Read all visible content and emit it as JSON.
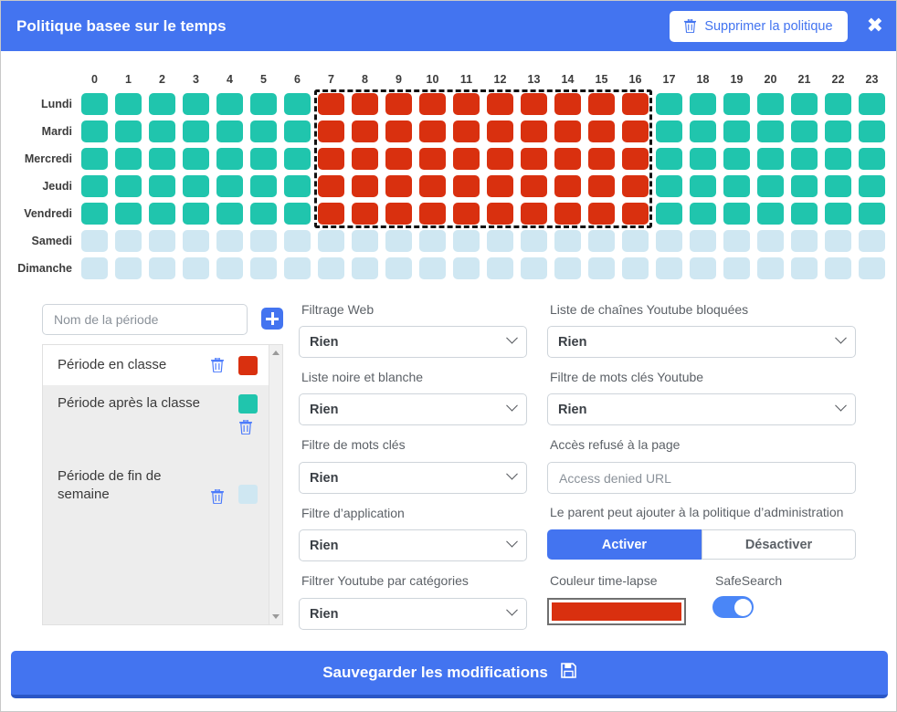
{
  "header": {
    "title": "Politique basee sur le temps",
    "delete_policy_label": "Supprimer la politique",
    "delete_icon": "trash-icon",
    "close_icon": "close-icon"
  },
  "schedule": {
    "hours": [
      "0",
      "1",
      "2",
      "3",
      "4",
      "5",
      "6",
      "7",
      "8",
      "9",
      "10",
      "11",
      "12",
      "13",
      "14",
      "15",
      "16",
      "17",
      "18",
      "19",
      "20",
      "21",
      "22",
      "23"
    ],
    "days": [
      "Lundi",
      "Mardi",
      "Mercredi",
      "Jeudi",
      "Vendredi",
      "Samedi",
      "Dimanche"
    ],
    "colors": {
      "in_class": "#d9300f",
      "after_class": "#20c5ad",
      "weekend": "#cfe7f2",
      "selection_border": "#111111"
    },
    "cells": [
      [
        "after_class",
        "after_class",
        "after_class",
        "after_class",
        "after_class",
        "after_class",
        "after_class",
        "in_class",
        "in_class",
        "in_class",
        "in_class",
        "in_class",
        "in_class",
        "in_class",
        "in_class",
        "in_class",
        "in_class",
        "after_class",
        "after_class",
        "after_class",
        "after_class",
        "after_class",
        "after_class",
        "after_class"
      ],
      [
        "after_class",
        "after_class",
        "after_class",
        "after_class",
        "after_class",
        "after_class",
        "after_class",
        "in_class",
        "in_class",
        "in_class",
        "in_class",
        "in_class",
        "in_class",
        "in_class",
        "in_class",
        "in_class",
        "in_class",
        "after_class",
        "after_class",
        "after_class",
        "after_class",
        "after_class",
        "after_class",
        "after_class"
      ],
      [
        "after_class",
        "after_class",
        "after_class",
        "after_class",
        "after_class",
        "after_class",
        "after_class",
        "in_class",
        "in_class",
        "in_class",
        "in_class",
        "in_class",
        "in_class",
        "in_class",
        "in_class",
        "in_class",
        "in_class",
        "after_class",
        "after_class",
        "after_class",
        "after_class",
        "after_class",
        "after_class",
        "after_class"
      ],
      [
        "after_class",
        "after_class",
        "after_class",
        "after_class",
        "after_class",
        "after_class",
        "after_class",
        "in_class",
        "in_class",
        "in_class",
        "in_class",
        "in_class",
        "in_class",
        "in_class",
        "in_class",
        "in_class",
        "in_class",
        "after_class",
        "after_class",
        "after_class",
        "after_class",
        "after_class",
        "after_class",
        "after_class"
      ],
      [
        "after_class",
        "after_class",
        "after_class",
        "after_class",
        "after_class",
        "after_class",
        "after_class",
        "in_class",
        "in_class",
        "in_class",
        "in_class",
        "in_class",
        "in_class",
        "in_class",
        "in_class",
        "in_class",
        "in_class",
        "after_class",
        "after_class",
        "after_class",
        "after_class",
        "after_class",
        "after_class",
        "after_class"
      ],
      [
        "weekend",
        "weekend",
        "weekend",
        "weekend",
        "weekend",
        "weekend",
        "weekend",
        "weekend",
        "weekend",
        "weekend",
        "weekend",
        "weekend",
        "weekend",
        "weekend",
        "weekend",
        "weekend",
        "weekend",
        "weekend",
        "weekend",
        "weekend",
        "weekend",
        "weekend",
        "weekend",
        "weekend"
      ],
      [
        "weekend",
        "weekend",
        "weekend",
        "weekend",
        "weekend",
        "weekend",
        "weekend",
        "weekend",
        "weekend",
        "weekend",
        "weekend",
        "weekend",
        "weekend",
        "weekend",
        "weekend",
        "weekend",
        "weekend",
        "weekend",
        "weekend",
        "weekend",
        "weekend",
        "weekend",
        "weekend",
        "weekend"
      ]
    ],
    "selection": {
      "hour_start": 7,
      "hour_end": 16,
      "day_start": 0,
      "day_end": 4
    }
  },
  "periods": {
    "name_input_placeholder": "Nom de la période",
    "name_input_value": "",
    "add_icon": "plus-icon",
    "items": [
      {
        "label": "Période en classe",
        "color": "#d9300f",
        "selected": true,
        "trash_icon": "trash-icon"
      },
      {
        "label": "Période après la classe",
        "color": "#20c5ad",
        "selected": false,
        "trash_icon": "trash-icon"
      },
      {
        "label": "Période de fin de semaine",
        "color": "#cfe7f2",
        "selected": false,
        "trash_icon": "trash-icon"
      }
    ]
  },
  "form": {
    "web_filter": {
      "label": "Filtrage Web",
      "value": "Rien"
    },
    "black_white_list": {
      "label": "Liste noire et blanche",
      "value": "Rien"
    },
    "keyword_filter": {
      "label": "Filtre de mots clés",
      "value": "Rien"
    },
    "app_filter": {
      "label": "Filtre d’application",
      "value": "Rien"
    },
    "youtube_categories": {
      "label": "Filtrer Youtube par catégories",
      "value": "Rien"
    },
    "youtube_channels": {
      "label": "Liste de chaînes Youtube bloquées",
      "value": "Rien"
    },
    "youtube_keywords": {
      "label": "Filtre de mots clés Youtube",
      "value": "Rien"
    },
    "denied_page": {
      "label": "Accès refusé à la page",
      "placeholder": "Access denied URL",
      "value": ""
    },
    "parent_policy": {
      "label": "Le parent peut ajouter à la politique d’administration",
      "enable_label": "Activer",
      "disable_label": "Désactiver",
      "selected": "Activer"
    },
    "timelapse_color": {
      "label": "Couleur time-lapse",
      "value": "#d9300f"
    },
    "safesearch": {
      "label": "SafeSearch",
      "state": "on"
    }
  },
  "footer": {
    "save_label": "Sauvegarder les modifications",
    "save_icon": "floppy-disk-icon"
  }
}
